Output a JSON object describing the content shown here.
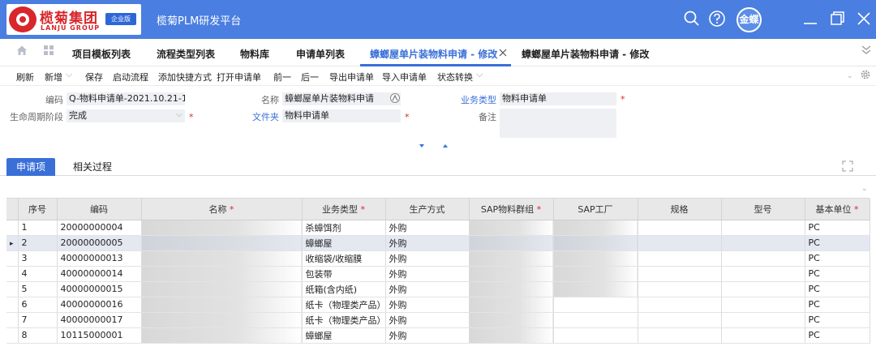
{
  "header": {
    "logo_cn": "榄菊集团",
    "logo_en": "LANJU GROUP",
    "logo_badge": "企业版",
    "app_title": "榄菊PLM研发平台",
    "avatar": "金蝶"
  },
  "tabs": [
    {
      "label": "项目模板列表"
    },
    {
      "label": "流程类型列表"
    },
    {
      "label": "物料库"
    },
    {
      "label": "申请单列表"
    },
    {
      "label": "蟑螂屋单片装物料申请 - 修改"
    },
    {
      "label": "蟑螂屋单片装物料申请 - 修改"
    }
  ],
  "toolbar": [
    "刷新",
    "新增",
    "保存",
    "启动流程",
    "添加快捷方式",
    "打开申请单",
    "前一",
    "后一",
    "导出申请单",
    "导入申请单",
    "状态转换"
  ],
  "form": {
    "code_label": "编码",
    "code_value": "Q-物料申请单-2021.10.21-12",
    "name_label": "名称",
    "name_value": "蟑螂屋单片装物料申请",
    "biz_label": "业务类型",
    "biz_value": "物料申请单",
    "lifecycle_label": "生命周期阶段",
    "lifecycle_value": "完成",
    "folder_label": "文件夹",
    "folder_value": "物料申请单",
    "remark_label": "备注",
    "required": "*"
  },
  "subtabs": [
    {
      "label": "申请项"
    },
    {
      "label": "相关过程"
    }
  ],
  "grid": {
    "columns": [
      "序号",
      "编码",
      "名称",
      "业务类型",
      "生产方式",
      "SAP物料群组",
      "SAP工厂",
      "规格",
      "型号",
      "基本单位"
    ],
    "rows": [
      {
        "no": "1",
        "code": "20000000004",
        "name": "蟑",
        "biz": "杀蟑饵剂",
        "mode": "外购",
        "unit": "PC"
      },
      {
        "no": "2",
        "code": "20000000005",
        "name": "蟑",
        "biz": "蟑螂屋",
        "mode": "外购",
        "unit": "PC"
      },
      {
        "no": "3",
        "code": "40000000013",
        "name": "收缩",
        "biz": "收缩袋/收缩膜",
        "mode": "外购",
        "unit": "PC"
      },
      {
        "no": "4",
        "code": "40000000014",
        "name": "榄",
        "biz": "包装带",
        "mode": "外购",
        "unit": "PC"
      },
      {
        "no": "5",
        "code": "40000000015",
        "name": "榄",
        "biz": "纸箱(含内纸)",
        "mode": "外购",
        "unit": "PC"
      },
      {
        "no": "6",
        "code": "40000000016",
        "name": "榄菊",
        "biz": "纸卡（物理类产品）",
        "mode": "外购",
        "unit": "PC"
      },
      {
        "no": "7",
        "code": "40000000017",
        "name": "蟑螂",
        "biz": "纸卡（物理类产品）",
        "mode": "外购",
        "unit": "PC"
      },
      {
        "no": "8",
        "code": "10115000001",
        "name": "榄菊",
        "biz": "蟑螂屋",
        "mode": "外购",
        "unit": "PC"
      }
    ]
  }
}
